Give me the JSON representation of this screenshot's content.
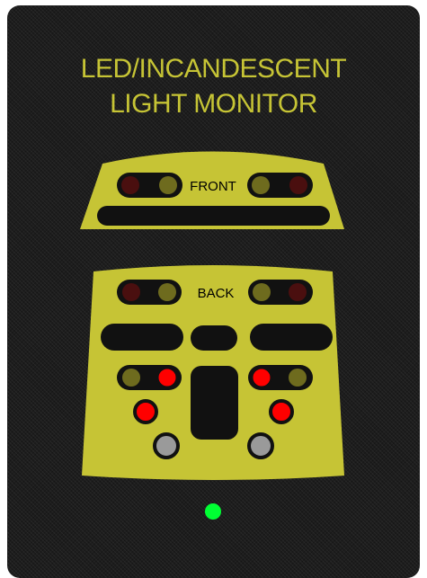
{
  "title_line1": "LED/INCANDESCENT",
  "title_line2": "LIGHT MONITOR",
  "front_label": "FRONT",
  "back_label": "BACK",
  "colors": {
    "panel": "#1d1d1d",
    "accent": "#c6c435",
    "led_dark_red": "#4a0f0f",
    "led_dark_olive": "#6e6b1e",
    "led_red": "#ff0000",
    "led_gray": "#9a9a9a",
    "led_green": "#00ff33"
  }
}
